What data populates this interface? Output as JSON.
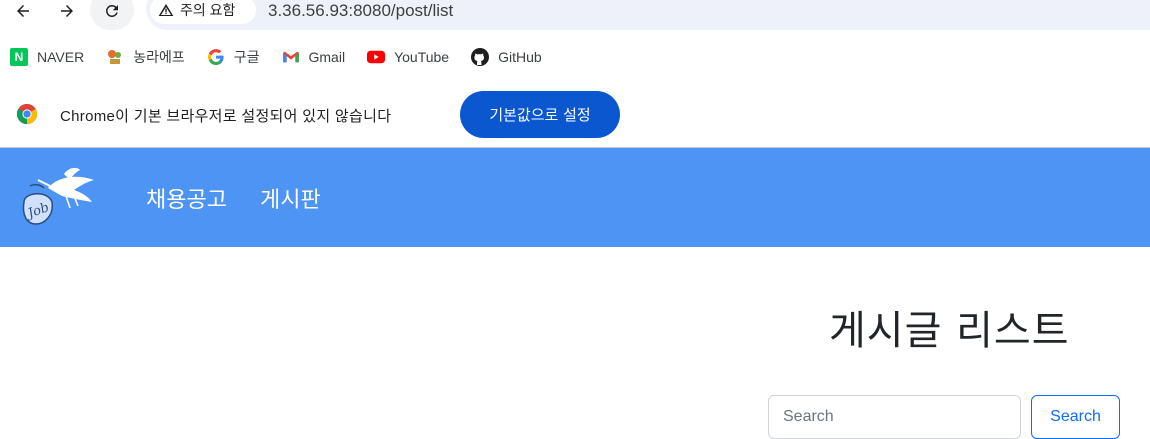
{
  "browser": {
    "security_chip": {
      "label": "주의 요함",
      "icon": "warning-icon"
    },
    "url": "3.36.56.93:8080/post/list",
    "bookmarks": [
      {
        "label": "NAVER",
        "icon": "naver-icon"
      },
      {
        "label": "농라에프",
        "icon": "nongra-icon"
      },
      {
        "label": "구글",
        "icon": "google-icon"
      },
      {
        "label": "Gmail",
        "icon": "gmail-icon"
      },
      {
        "label": "YouTube",
        "icon": "youtube-icon"
      },
      {
        "label": "GitHub",
        "icon": "github-icon"
      }
    ],
    "infobar": {
      "message": "Chrome이 기본 브라우저로 설정되어 있지 않습니다",
      "button_label": "기본값으로 설정"
    }
  },
  "site": {
    "nav": {
      "items": [
        {
          "label": "채용공고"
        },
        {
          "label": "게시판"
        }
      ]
    },
    "colors": {
      "nav_bg": "#4d94f4",
      "primary": "#0d6efd"
    }
  },
  "main": {
    "title": "게시글 리스트",
    "search": {
      "placeholder": "Search",
      "button_label": "Search"
    }
  }
}
